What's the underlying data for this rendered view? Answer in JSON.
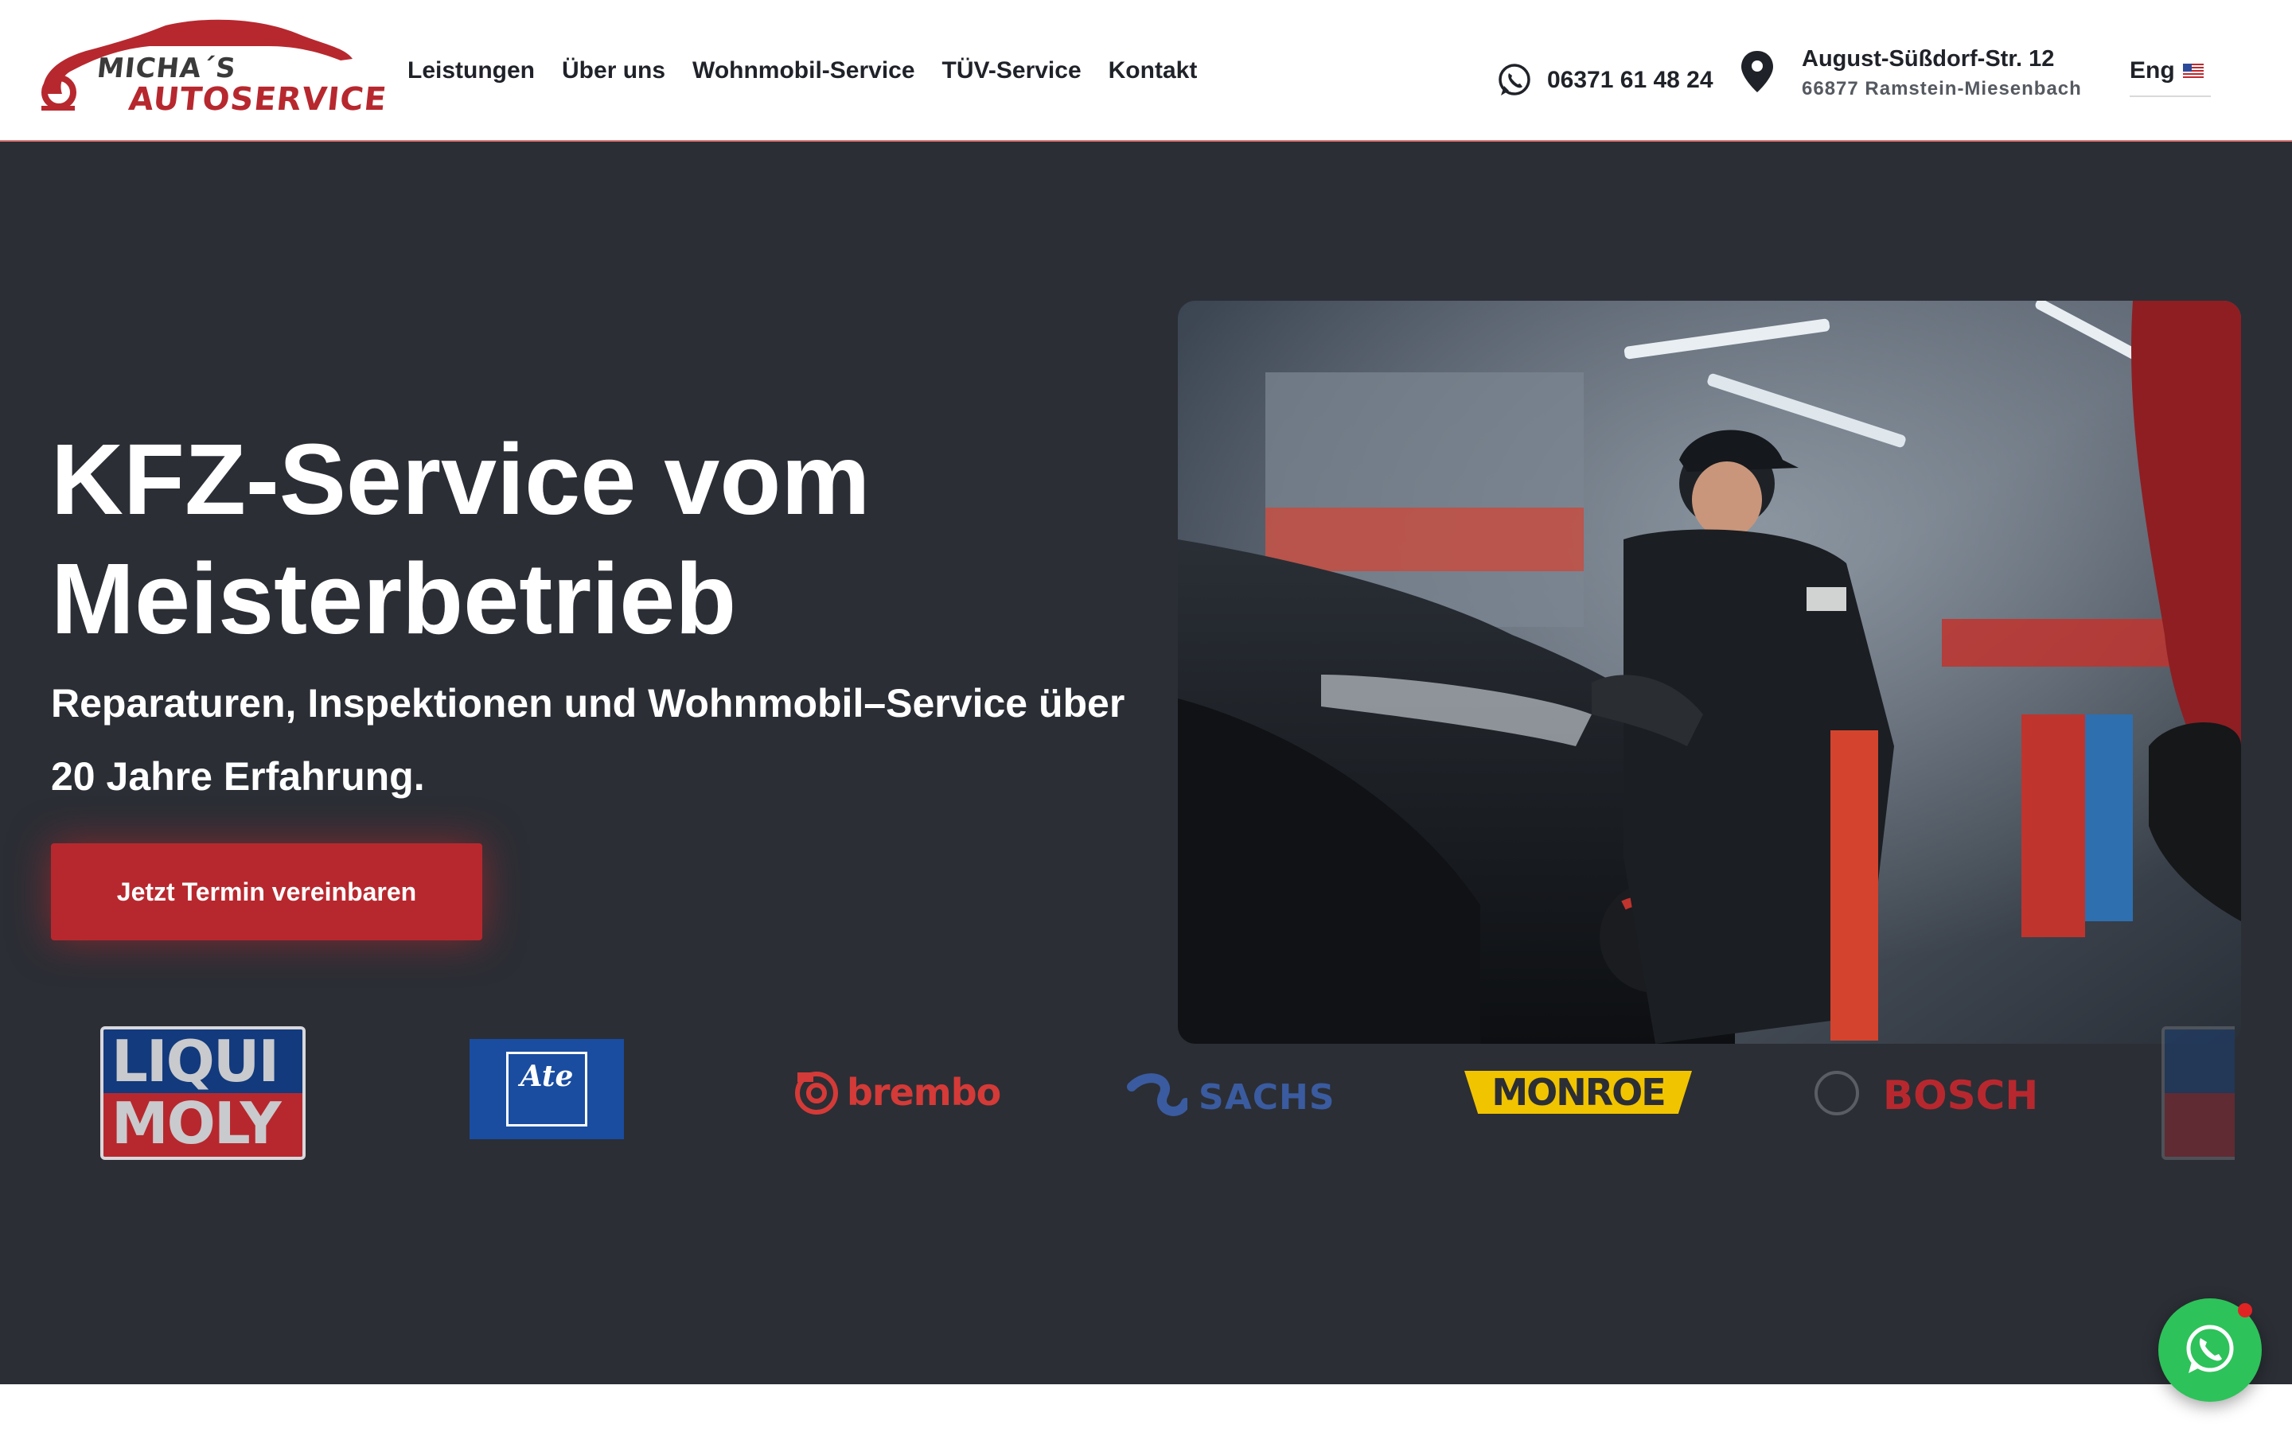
{
  "brand": {
    "line1": "MICHA´S",
    "line2": "AUTOSERVICE",
    "accent_color": "#b7282e"
  },
  "nav": {
    "items": [
      {
        "label": "Leistungen"
      },
      {
        "label": "Über uns"
      },
      {
        "label": "Wohnmobil-Service"
      },
      {
        "label": "TÜV-Service"
      },
      {
        "label": "Kontakt"
      }
    ]
  },
  "contact": {
    "phone": "06371 61 48 24",
    "phone_icon": "whatsapp-icon",
    "address_line1": "August-Süßdorf-Str. 12",
    "address_line2": "66877 Ramstein-Miesenbach",
    "address_icon": "location-pin-icon"
  },
  "language": {
    "label": "Eng",
    "flag": "us-flag-icon"
  },
  "hero": {
    "title": "KFZ-Service vom Meisterbetrieb",
    "subtitle": "Reparaturen, Inspektionen und Wohnmobil–Service über 20 Jahre Erfahrung.",
    "cta_label": "Jetzt Termin vereinbaren",
    "background": "#2b2e35"
  },
  "brands": {
    "liqui_moly": {
      "line1": "LIQUI",
      "line2": "MOLY"
    },
    "ate": {
      "text": "Ate"
    },
    "brembo": {
      "text": "brembo"
    },
    "sachs": {
      "text": "SACHS"
    },
    "monroe": {
      "text": "MONROE"
    },
    "bosch": {
      "text": "BOSCH"
    }
  },
  "floating": {
    "whatsapp_icon": "whatsapp-icon",
    "notification_color": "#e02424",
    "button_color": "#2ec25a"
  }
}
